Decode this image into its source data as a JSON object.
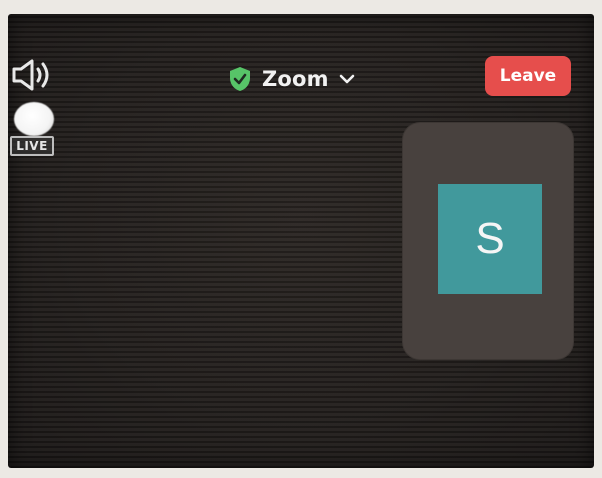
{
  "meeting": {
    "title": "Zoom",
    "leave_label": "Leave",
    "live_label": "LIVE"
  },
  "self_view": {
    "avatar_initial": "S"
  },
  "icons": {
    "speaker": "speaker-icon",
    "security": "shield-check-icon",
    "dropdown": "chevron-down-icon"
  },
  "colors": {
    "leave": "#e64e4c",
    "avatar": "#41999c",
    "shield": "#57c468"
  }
}
